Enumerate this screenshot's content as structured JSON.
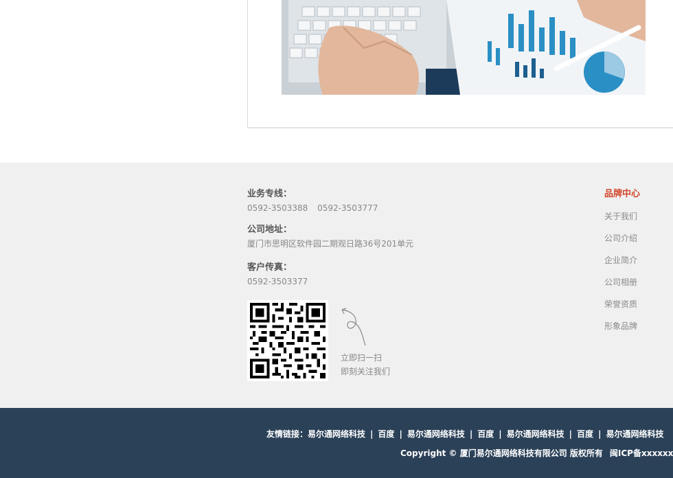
{
  "contact": {
    "business_title": "业务专线：",
    "phone1": "0592-3503388",
    "phone2": "0592-3503777",
    "address_title": "公司地址：",
    "address": "厦门市思明区软件园二期观日路36号201单元",
    "fax_title": "客户传真：",
    "fax": "0592-3503377"
  },
  "qr": {
    "line1": "立即扫一扫",
    "line2": "即刻关注我们"
  },
  "brand_nav": {
    "title": "品牌中心",
    "items": [
      "关于我们",
      "公司介绍",
      "企业简介",
      "公司相册",
      "荣誉资质",
      "形象品牌"
    ]
  },
  "friend_links": {
    "label": "友情链接：",
    "items": [
      "易尔通网络科技",
      "百度",
      "易尔通网络科技",
      "百度",
      "易尔通网络科技",
      "百度",
      "易尔通网络科技"
    ],
    "separator": "|"
  },
  "copyright": {
    "text": "Copyright © 厦门易尔通网络科技有限公司 版权所有",
    "icp": "闽ICP备xxxxxxxx号"
  },
  "colors": {
    "accent": "#d2462b",
    "footer_bg": "#f0f0f0",
    "bottom_bar": "#2b4158"
  }
}
